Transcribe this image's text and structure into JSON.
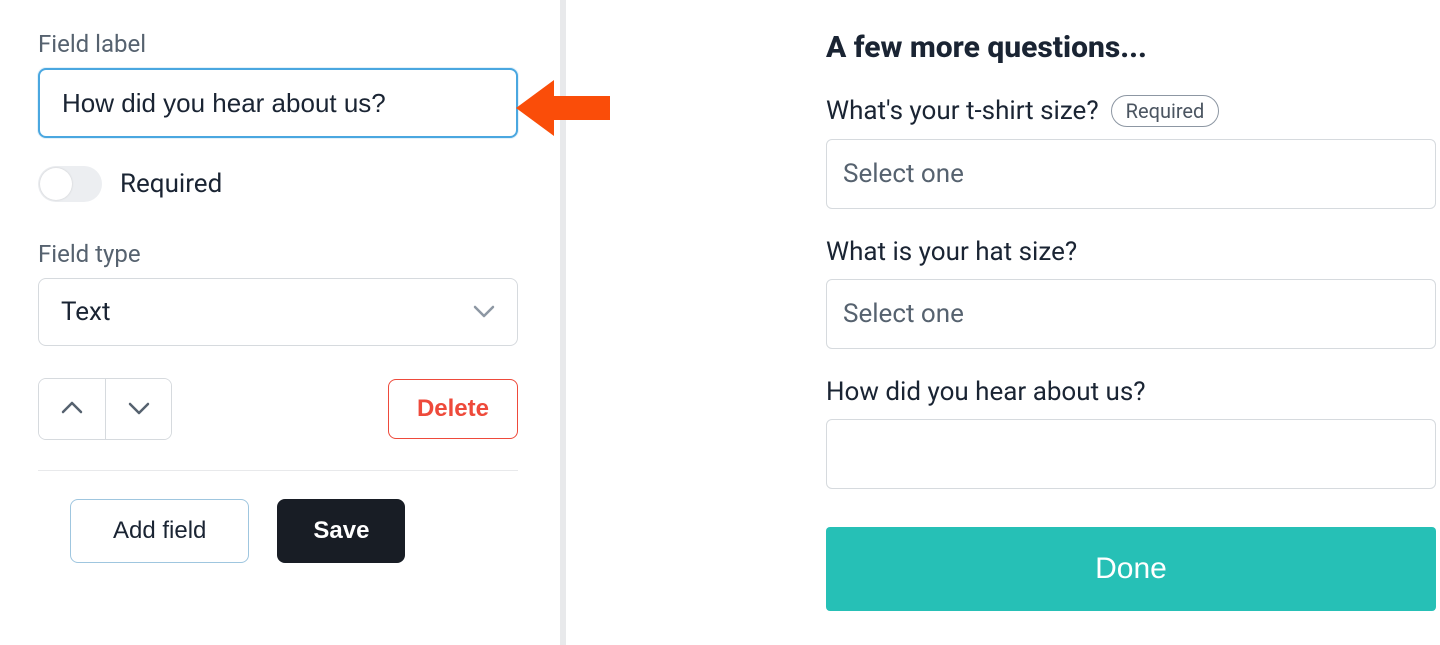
{
  "editor": {
    "field_label_heading": "Field label",
    "field_label_value": "How did you hear about us?",
    "required_toggle_label": "Required",
    "required_toggle_on": false,
    "field_type_heading": "Field type",
    "field_type_value": "Text",
    "delete_label": "Delete",
    "add_field_label": "Add field",
    "save_label": "Save"
  },
  "preview": {
    "heading": "A few more questions...",
    "required_pill": "Required",
    "fields": [
      {
        "label": "What's your t-shirt size?",
        "required": true,
        "placeholder": "Select one",
        "type": "select"
      },
      {
        "label": "What is your hat size?",
        "required": false,
        "placeholder": "Select one",
        "type": "select"
      },
      {
        "label": "How did you hear about us?",
        "required": false,
        "placeholder": "",
        "type": "text"
      }
    ],
    "done_label": "Done"
  },
  "colors": {
    "accent_blue": "#4aa7e0",
    "danger": "#ee4a3b",
    "teal": "#26c0b6",
    "arrow": "#fa4d09"
  }
}
